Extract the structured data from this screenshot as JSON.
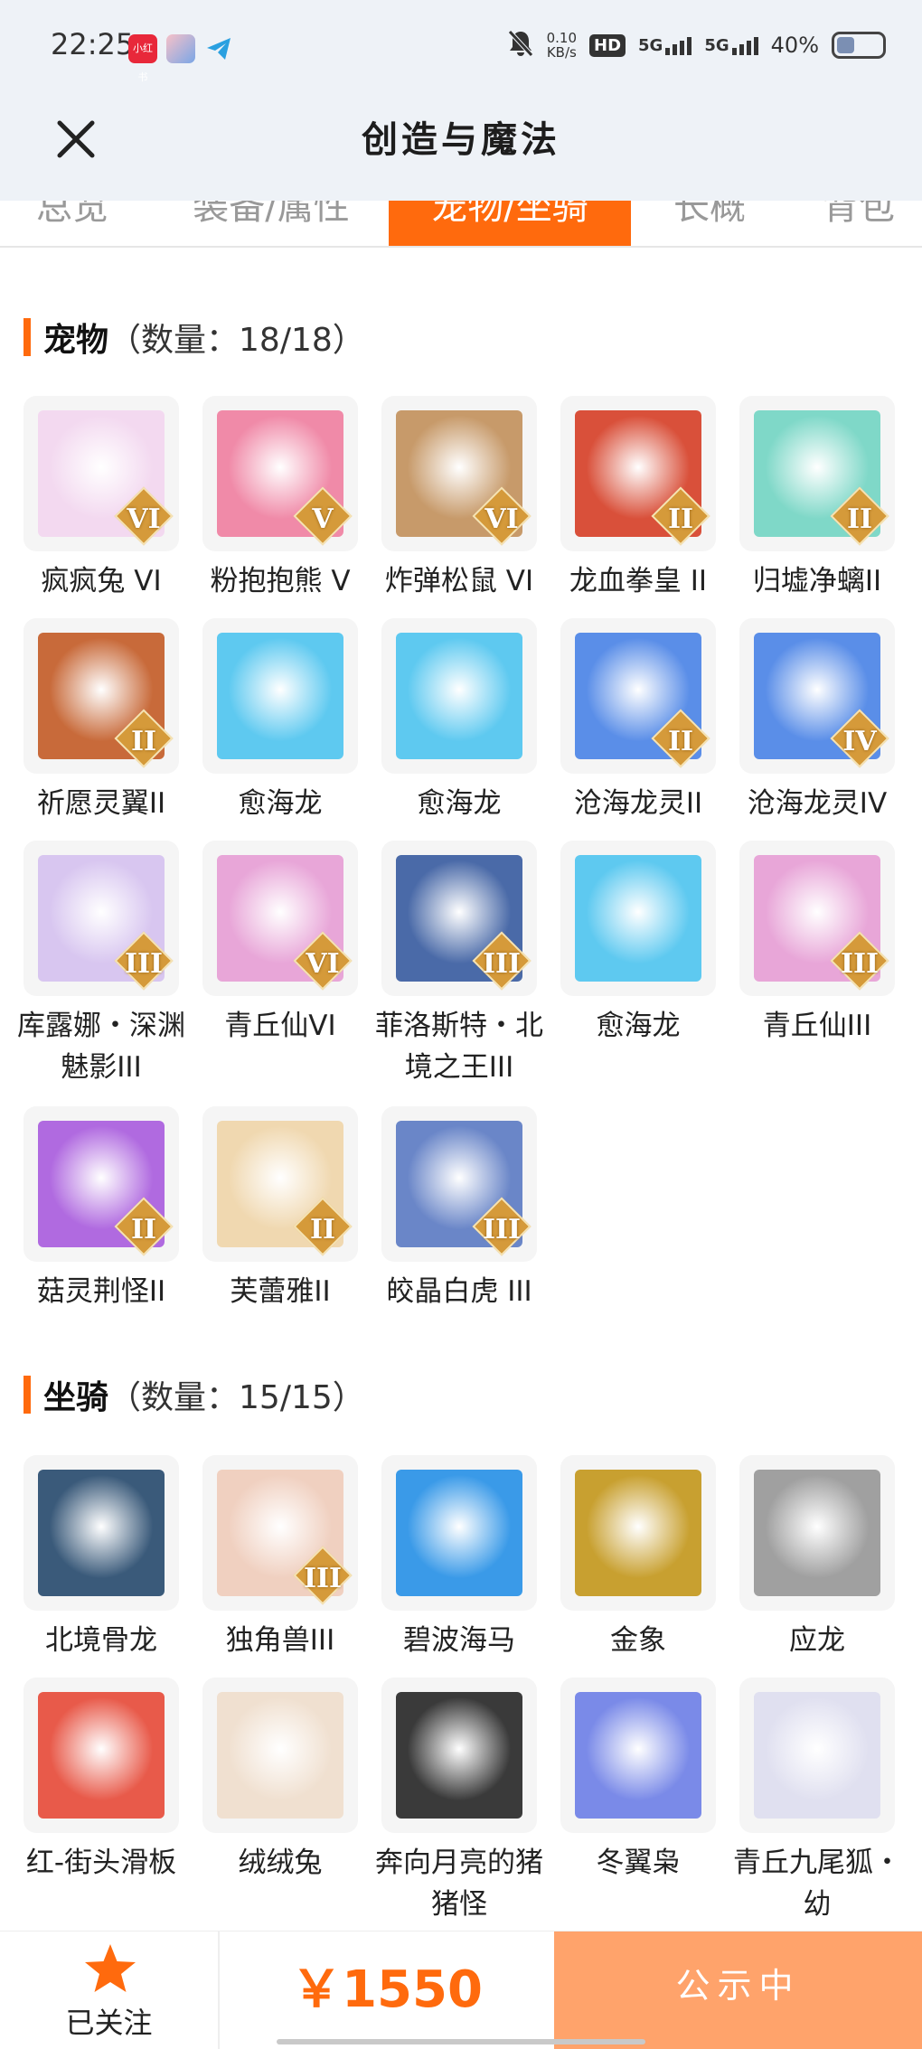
{
  "status_bar": {
    "time": "22:25",
    "speed_top": "0.10",
    "speed_unit": "KB/s",
    "hd": "HD",
    "net1": "5G",
    "net2": "5G",
    "battery_text": "40%",
    "battery_level": 0.4
  },
  "header": {
    "title": "创造与魔法"
  },
  "tabs": [
    {
      "label": "总览",
      "active": false
    },
    {
      "label": "装备/属性",
      "active": false
    },
    {
      "label": "宠物/坐骑",
      "active": true
    },
    {
      "label": "长概",
      "active": false
    },
    {
      "label": "背包",
      "active": false
    }
  ],
  "pets": {
    "title": "宠物",
    "count": "（数量：18/18）",
    "items": [
      {
        "name": "疯疯兔 VI",
        "badge": "VI",
        "color": "#f3d9f0"
      },
      {
        "name": "粉抱抱熊 V",
        "badge": "V",
        "color": "#f08aa8"
      },
      {
        "name": "炸弹松鼠 VI",
        "badge": "VI",
        "color": "#c79a6a"
      },
      {
        "name": "龙血拳皇 II",
        "badge": "II",
        "color": "#d9503a"
      },
      {
        "name": "归墟净螭II",
        "badge": "II",
        "color": "#7fd8c8"
      },
      {
        "name": "祈愿灵翼II",
        "badge": "II",
        "color": "#c86a3a"
      },
      {
        "name": "愈海龙",
        "badge": "",
        "color": "#5ec9f0"
      },
      {
        "name": "愈海龙",
        "badge": "",
        "color": "#5ec9f0"
      },
      {
        "name": "沧海龙灵II",
        "badge": "II",
        "color": "#5a8ee8"
      },
      {
        "name": "沧海龙灵IV",
        "badge": "IV",
        "color": "#5a8ee8"
      },
      {
        "name": "库露娜・深渊魅影III",
        "badge": "III",
        "color": "#d8c6f0"
      },
      {
        "name": "青丘仙VI",
        "badge": "VI",
        "color": "#e8a6d8"
      },
      {
        "name": "菲洛斯特・北境之王III",
        "badge": "III",
        "color": "#4a6aa8"
      },
      {
        "name": "愈海龙",
        "badge": "",
        "color": "#5ec9f0"
      },
      {
        "name": "青丘仙III",
        "badge": "III",
        "color": "#e8a6d8"
      },
      {
        "name": "菇灵荆怪II",
        "badge": "II",
        "color": "#b06ae0"
      },
      {
        "name": "芙蕾雅II",
        "badge": "II",
        "color": "#f0d8b0"
      },
      {
        "name": "皎晶白虎 III",
        "badge": "III",
        "color": "#6a86c8"
      }
    ]
  },
  "mounts": {
    "title": "坐骑",
    "count": "（数量：15/15）",
    "items": [
      {
        "name": "北境骨龙",
        "badge": "",
        "color": "#3a5a7a"
      },
      {
        "name": "独角兽III",
        "badge": "III",
        "color": "#f0d0c0"
      },
      {
        "name": "碧波海马",
        "badge": "",
        "color": "#3a9ae8"
      },
      {
        "name": "金象",
        "badge": "",
        "color": "#c8a030"
      },
      {
        "name": "应龙",
        "badge": "",
        "color": "#a0a0a0"
      },
      {
        "name": "红-街头滑板",
        "badge": "",
        "color": "#e85a4a"
      },
      {
        "name": "绒绒兔",
        "badge": "",
        "color": "#f0e0d0"
      },
      {
        "name": "奔向月亮的猪猪怪",
        "badge": "",
        "color": "#3a3a3a"
      },
      {
        "name": "冬翼枭",
        "badge": "",
        "color": "#7a8ae8"
      },
      {
        "name": "青丘九尾狐・幼",
        "badge": "",
        "color": "#e0e0f0"
      }
    ]
  },
  "bottom": {
    "follow_label": "已关注",
    "price": "￥1550",
    "public_label": "公示中"
  },
  "colors": {
    "accent": "#ff6a0d",
    "public_bg": "#ffa36b"
  }
}
